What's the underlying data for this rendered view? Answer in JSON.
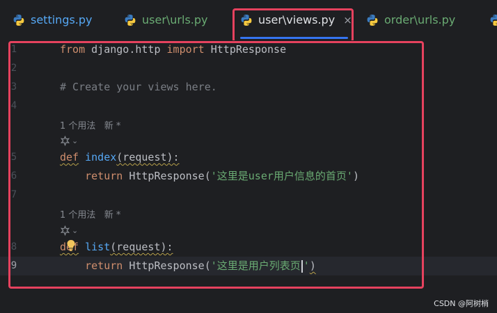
{
  "tabs": [
    {
      "label": "settings.py",
      "color": "#56a8f5",
      "active": false
    },
    {
      "label": "user\\urls.py",
      "color": "#6aab73",
      "active": false
    },
    {
      "label": "user\\views.py",
      "color": "#dfe1e5",
      "active": true,
      "close": "×"
    },
    {
      "label": "order\\urls.py",
      "color": "#6aab73",
      "active": false
    }
  ],
  "editor": {
    "line_numbers": [
      "1",
      "2",
      "3",
      "4",
      "5",
      "6",
      "7",
      "8",
      "9"
    ],
    "line1": {
      "kw1": "from",
      "mod": " django.http ",
      "kw2": "import",
      "name": " HttpResponse"
    },
    "line3": {
      "comment": "# Create your views here."
    },
    "hint1": "1 个用法   新 *",
    "line5": {
      "kw": "def",
      "fn": "index",
      "args": "(request):"
    },
    "line6": {
      "indent": "    ",
      "kw": "return",
      "call": " HttpResponse(",
      "str": "'这里是user用户信息的首页'",
      "close": ")"
    },
    "hint2": "1 个用法   新 *",
    "line8": {
      "kw": "def",
      "fn": "list",
      "args": "(request):"
    },
    "line9": {
      "indent": "    ",
      "kw": "return",
      "call": " HttpResponse(",
      "str1": "'这里是用户列表页",
      "str2": "'",
      "close": ")"
    }
  },
  "colors": {
    "accent": "#3574f0",
    "annotation_border": "#e6425e",
    "keyword": "#cf8e6d",
    "function": "#56a8f5",
    "string": "#6aab73",
    "comment": "#7a7e85"
  },
  "watermark": "CSDN @阿树梢"
}
